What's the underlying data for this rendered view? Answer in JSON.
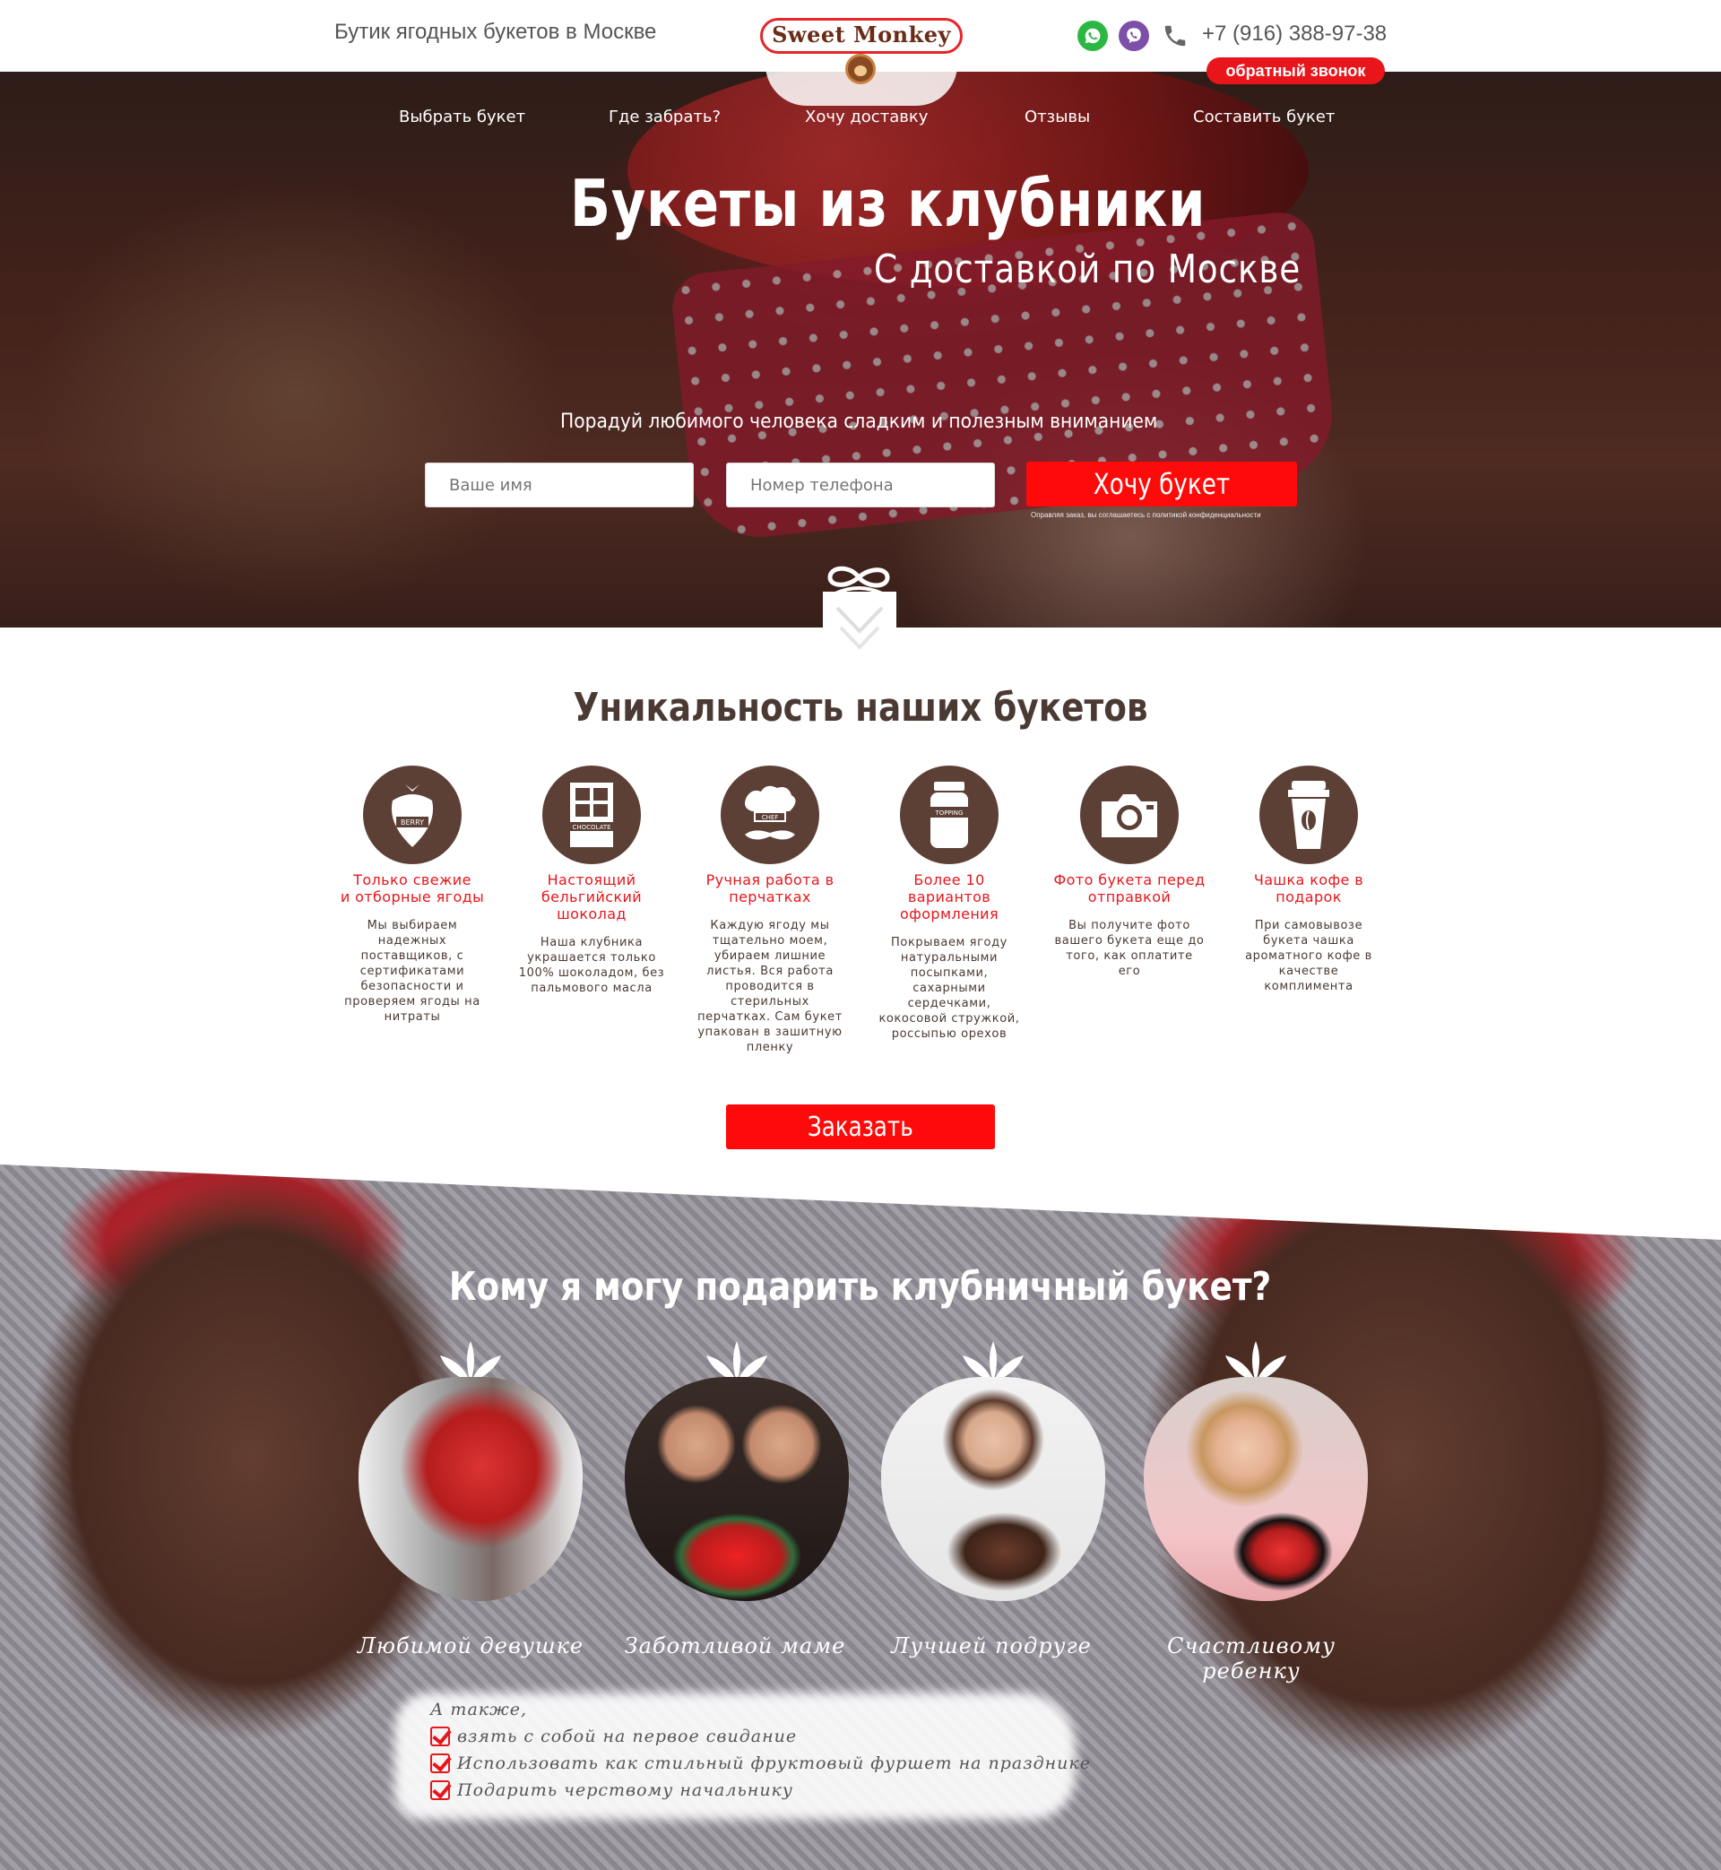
{
  "header": {
    "tagline": "Бутик ягодных букетов в Москве",
    "logo": "Sweet Monkey",
    "phone": "+7 (916) 388-97-38",
    "callback": "обратный звонок",
    "icons": [
      "whatsapp-icon",
      "viber-icon",
      "phone-icon"
    ]
  },
  "nav": {
    "items": [
      {
        "label": "Выбрать букет"
      },
      {
        "label": "Где забрать?"
      },
      {
        "label": "Хочу доставку"
      },
      {
        "label": "Отзывы"
      },
      {
        "label": "Составить букет"
      }
    ]
  },
  "hero": {
    "title": "Букеты из клубники",
    "subtitle": "С доставкой по Москве",
    "lead": "Порадуй любимого человека сладким и полезным вниманием",
    "name_placeholder": "Ваше имя",
    "phone_placeholder": "Номер телефона",
    "button": "Хочу букет",
    "privacy": "Оправляя заказ, вы соглашаетесь с политикой конфиденциальности"
  },
  "uniqueness": {
    "title": "Уникальность наших букетов",
    "features": [
      {
        "icon": "berry-icon",
        "icon_label": "BERRY",
        "title": "Только свежие\nи отборные ягоды",
        "text": "Мы выбираем надежных поставщиков, с сертификатами безопасности и проверяем ягоды на нитраты"
      },
      {
        "icon": "chocolate-icon",
        "icon_label": "CHOCOLATE",
        "title": "Настоящий бельгийский шоколад",
        "text": "Наша клубника украшается только 100% шоколадом, без пальмового масла"
      },
      {
        "icon": "chef-icon",
        "icon_label": "CHEF",
        "title": "Ручная работа в перчатках",
        "text": "Каждую ягоду мы тщательно моем, убираем лишние листья. Вся работа проводится в стерильных перчатках. Сам букет упакован в зашитную пленку"
      },
      {
        "icon": "topping-jar-icon",
        "icon_label": "TOPPING",
        "title": "Более 10 вариантов оформления",
        "text": "Покрываем ягоду натуральными посыпками, сахарными сердечками, кокосовой стружкой, россыпью орехов"
      },
      {
        "icon": "camera-icon",
        "icon_label": "",
        "title": "Фото букета перед отправкой",
        "text": "Вы получите фото вашего букета еще до того, как оплатите его"
      },
      {
        "icon": "coffee-cup-icon",
        "icon_label": "",
        "title": "Чашка кофе в подарок",
        "text": "При самовывозе букета чашка ароматного кофе в качестве комплимента"
      }
    ],
    "button": "Заказать"
  },
  "gift": {
    "title": "Кому я могу подарить клубничный букет?",
    "people": [
      {
        "caption": "Любимой девушке"
      },
      {
        "caption": "Заботливой маме"
      },
      {
        "caption": "Лучшей подруге"
      },
      {
        "caption": "Счастливому ребенку"
      }
    ],
    "also_lead": "А также,",
    "also_items": [
      "взять с собой на первое свидание",
      "Использовать как стильный фруктовый фуршет на празднике",
      "Подарить черствому начальнику"
    ]
  },
  "colors": {
    "accent": "#ff0a0a",
    "brand_brown": "#5c4036",
    "text": "#4a3a33"
  }
}
